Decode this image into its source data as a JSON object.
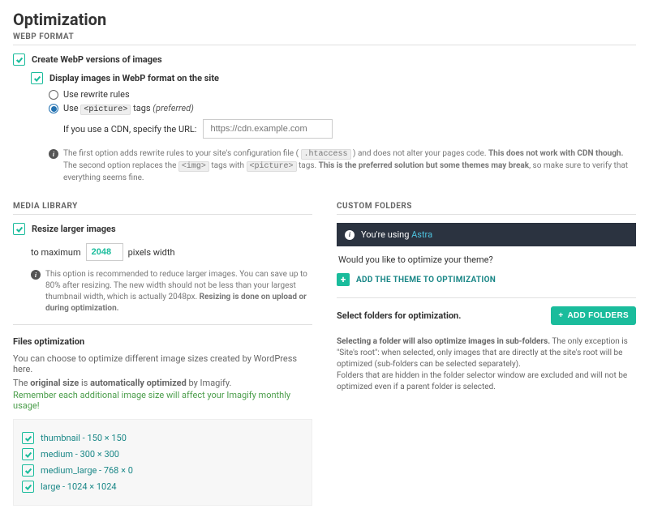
{
  "title": "Optimization",
  "webp": {
    "section_label": "WEBP FORMAT",
    "create_label": "Create WebP versions of images",
    "display_label": "Display images in WebP format on the site",
    "radio_rewrite": "Use rewrite rules",
    "radio_picture_prefix": "Use ",
    "radio_picture_tag": "<picture>",
    "radio_picture_suffix": " tags ",
    "radio_picture_hint": "(preferred)",
    "cdn_label": "If you use a CDN, specify the URL:",
    "cdn_placeholder": "https://cdn.example.com",
    "info1_a": "The first option adds rewrite rules to your site's configuration file ( ",
    "info1_code": ".htaccess",
    "info1_b": " ) and does not alter your pages code. ",
    "info1_strong": "This does not work with CDN though.",
    "info2_a": "The second option replaces the ",
    "info2_code1": "<img>",
    "info2_b": " tags with ",
    "info2_code2": "<picture>",
    "info2_c": " tags. ",
    "info2_strong": "This is the preferred solution but some themes may break",
    "info2_d": ", so make sure to verify that everything seems fine."
  },
  "media": {
    "section_label": "MEDIA LIBRARY",
    "resize_label": "Resize larger images",
    "to_max": "to maximum",
    "max_value": "2048",
    "px_width": "pixels width",
    "info_a": "This option is recommended to reduce larger images. You can save up to 80% after resizing. The new width should not be less than your largest thumbnail width, which is actually 2048px. ",
    "info_strong": "Resizing is done on upload or during optimization.",
    "files_title": "Files optimization",
    "files_desc": "You can choose to optimize different image sizes created by WordPress here.",
    "files_line2_a": "The ",
    "files_line2_b": "original size",
    "files_line2_c": " is ",
    "files_line2_d": "automatically optimized",
    "files_line2_e": " by Imagify.",
    "files_line3": "Remember each additional image size will affect your Imagify monthly usage!",
    "sizes": [
      "thumbnail - 150 × 150",
      "medium - 300 × 300",
      "medium_large - 768 × 0",
      "large - 1024 × 1024"
    ]
  },
  "custom": {
    "section_label": "CUSTOM FOLDERS",
    "banner_pre": "You're using ",
    "banner_theme": "Astra",
    "theme_q": "Would you like to optimize your theme?",
    "add_theme": "ADD THE THEME TO OPTIMIZATION",
    "select_label": "Select folders for optimization.",
    "add_folders_btn": "ADD FOLDERS",
    "note_strong": "Selecting a folder will also optimize images in sub-folders.",
    "note_a": " The only exception is \"Site's root\": when selected, only images that are directly at the site's root will be optimized (sub-folders can be selected separately).",
    "note_b": "Folders that are hidden in the folder selector window are excluded and will not be optimized even if a parent folder is selected."
  }
}
